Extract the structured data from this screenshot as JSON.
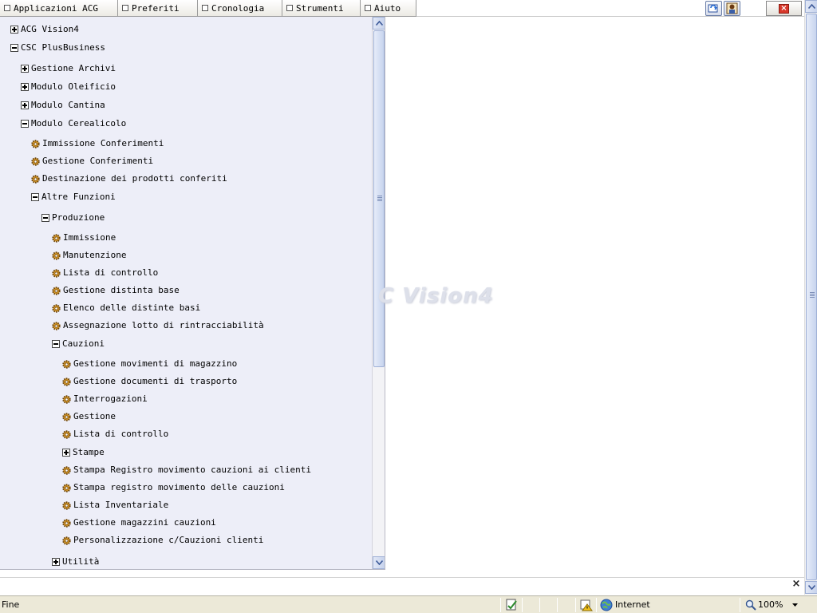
{
  "menu": {
    "tabs": [
      {
        "label": "Applicazioni ACG"
      },
      {
        "label": "Preferiti"
      },
      {
        "label": "Cronologia"
      },
      {
        "label": "Strumenti"
      },
      {
        "label": "Aiuto"
      }
    ],
    "close_label": "×"
  },
  "tree": {
    "nodes": [
      {
        "label": "ACG Vision4",
        "icon": "expand-plus"
      },
      {
        "label": "CSC PlusBusiness",
        "icon": "collapse-minus"
      },
      {
        "label": "Gestione Archivi",
        "icon": "expand-plus"
      },
      {
        "label": "Modulo Oleificio",
        "icon": "expand-plus"
      },
      {
        "label": "Modulo Cantina",
        "icon": "expand-plus"
      },
      {
        "label": "Modulo Cerealicolo",
        "icon": "collapse-minus"
      },
      {
        "label": "Immissione Conferimenti",
        "icon": "gear"
      },
      {
        "label": "Gestione Conferimenti",
        "icon": "gear"
      },
      {
        "label": "Destinazione dei prodotti conferiti",
        "icon": "gear"
      },
      {
        "label": "Altre Funzioni",
        "icon": "collapse-minus"
      },
      {
        "label": "Produzione",
        "icon": "collapse-minus"
      },
      {
        "label": "Immissione",
        "icon": "gear"
      },
      {
        "label": "Manutenzione",
        "icon": "gear"
      },
      {
        "label": "Lista di controllo",
        "icon": "gear"
      },
      {
        "label": "Gestione distinta base",
        "icon": "gear"
      },
      {
        "label": "Elenco delle distinte basi",
        "icon": "gear"
      },
      {
        "label": "Assegnazione lotto di rintracciabilità",
        "icon": "gear"
      },
      {
        "label": "Cauzioni",
        "icon": "collapse-minus"
      },
      {
        "label": "Gestione movimenti di magazzino",
        "icon": "gear"
      },
      {
        "label": "Gestione documenti di trasporto",
        "icon": "gear"
      },
      {
        "label": "Interrogazioni",
        "icon": "gear"
      },
      {
        "label": "Gestione",
        "icon": "gear"
      },
      {
        "label": "Lista di controllo",
        "icon": "gear"
      },
      {
        "label": "Stampe",
        "icon": "expand-plus"
      },
      {
        "label": "Stampa Registro movimento cauzioni ai clienti",
        "icon": "gear"
      },
      {
        "label": "Stampa registro movimento delle cauzioni",
        "icon": "gear"
      },
      {
        "label": "Lista Inventariale",
        "icon": "gear"
      },
      {
        "label": "Gestione magazzini cauzioni",
        "icon": "gear"
      },
      {
        "label": "Personalizzazione c/Cauzioni clienti",
        "icon": "gear"
      },
      {
        "label": "Utilità",
        "icon": "expand-plus"
      }
    ]
  },
  "content": {
    "watermark": "C Vision4"
  },
  "bottom": {
    "close_label": "×"
  },
  "status": {
    "text": "Fine",
    "zone": "Internet",
    "zoom": "100%"
  },
  "colors": {
    "tree_background": "#edeef8",
    "status_background": "#ece9d8",
    "close_red": "#d8382b"
  }
}
